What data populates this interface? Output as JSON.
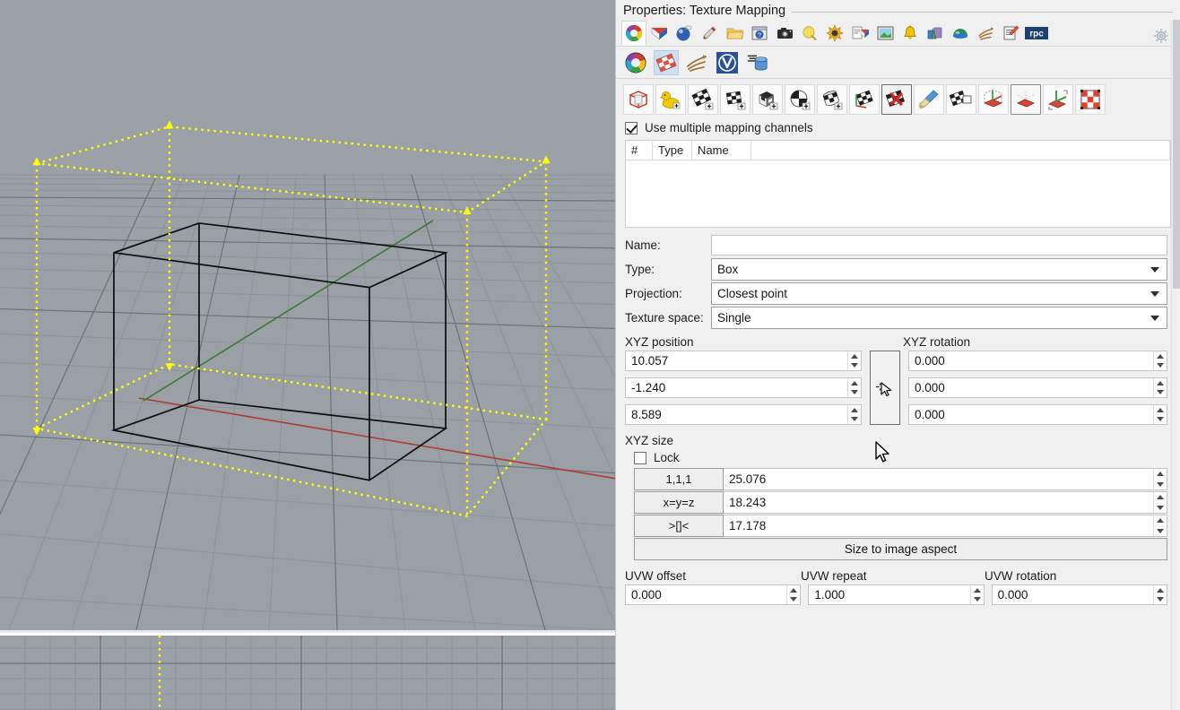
{
  "panel": {
    "title": "Properties: Texture Mapping",
    "gear_icon": "gear-icon"
  },
  "main_tabs": [
    {
      "name": "object-properties-tab",
      "icon": "color-wheel-icon",
      "selected": true
    },
    {
      "name": "layers-tab",
      "icon": "layers-icon",
      "selected": false
    },
    {
      "name": "material-tab",
      "icon": "material-sphere-icon",
      "selected": false
    },
    {
      "name": "display-tab",
      "icon": "paintbrush-icon",
      "selected": false
    },
    {
      "name": "folder-tab",
      "icon": "folder-icon",
      "selected": false
    },
    {
      "name": "help-tab",
      "icon": "help-window-icon",
      "selected": false
    },
    {
      "name": "camera-tab",
      "icon": "camera-icon",
      "selected": false
    },
    {
      "name": "light-tab",
      "icon": "lightbulb-icon",
      "selected": false
    },
    {
      "name": "sun-tab",
      "icon": "sun-icon",
      "selected": false
    },
    {
      "name": "print-width-tab",
      "icon": "document-layers-icon",
      "selected": false
    },
    {
      "name": "environment-tab",
      "icon": "picture-icon",
      "selected": false
    },
    {
      "name": "notification-tab",
      "icon": "bell-icon",
      "selected": false
    },
    {
      "name": "ground-plane-tab",
      "icon": "shapes-icon",
      "selected": false
    },
    {
      "name": "dome-tab",
      "icon": "dome-icon",
      "selected": false
    },
    {
      "name": "animation-tab",
      "icon": "claw-icon",
      "selected": false
    },
    {
      "name": "notes-tab",
      "icon": "notes-pencil-icon",
      "selected": false
    },
    {
      "name": "rpc-tab",
      "icon": "rpc-icon",
      "selected": false
    }
  ],
  "sub_tabs": [
    {
      "name": "color-sub-tab",
      "icon": "color-wheel-icon",
      "selected": false
    },
    {
      "name": "texture-mapping-sub-tab",
      "icon": "checker-plane-icon",
      "selected": true
    },
    {
      "name": "claw-sub-tab",
      "icon": "claw-icon",
      "selected": false
    },
    {
      "name": "vray-sub-tab",
      "icon": "vray-v-icon",
      "selected": false
    },
    {
      "name": "database-sub-tab",
      "icon": "database-cylinder-icon",
      "selected": false
    }
  ],
  "map_tools": [
    {
      "name": "show-mapping-widget-tool",
      "icon": "red-widget-icon",
      "state": "normal"
    },
    {
      "name": "duck-mapping-tool",
      "icon": "yellow-duck-icon",
      "state": "normal"
    },
    {
      "name": "planar-mapping-tool",
      "icon": "checker-plane-plus-icon",
      "state": "normal"
    },
    {
      "name": "planar-mapping-alt-tool",
      "icon": "checker-plane2-plus-icon",
      "state": "normal"
    },
    {
      "name": "box-mapping-tool",
      "icon": "checker-box-plus-icon",
      "state": "normal"
    },
    {
      "name": "sphere-mapping-tool",
      "icon": "checker-sphere-plus-icon",
      "state": "normal"
    },
    {
      "name": "cylinder-mapping-tool",
      "icon": "checker-cylinder-plus-icon",
      "state": "normal"
    },
    {
      "name": "custom-mapping-tool",
      "icon": "checker-axis-icon",
      "state": "normal"
    },
    {
      "name": "delete-mapping-tool",
      "icon": "checker-delete-red-x-icon",
      "state": "pressed"
    },
    {
      "name": "match-mapping-tool",
      "icon": "paintbrush-blue-icon",
      "state": "normal"
    },
    {
      "name": "copy-mapping-tool",
      "icon": "checker-copy-icon",
      "state": "normal"
    },
    {
      "name": "show-mapping-axes-tool",
      "icon": "axis-plane-dashed-icon",
      "state": "normal"
    },
    {
      "name": "unwrap-mapping-tool",
      "icon": "red-plane-icon",
      "state": "hover"
    },
    {
      "name": "apply-mapping-axes-tool",
      "icon": "axis-plane-green-icon",
      "state": "normal"
    },
    {
      "name": "checker-grid-tool",
      "icon": "red-checker-grid-icon",
      "state": "normal"
    }
  ],
  "multi_channel": {
    "label": "Use multiple mapping channels",
    "checked": true
  },
  "channel_list": {
    "columns": [
      "#",
      "Type",
      "Name"
    ],
    "rows": []
  },
  "fields": {
    "name_label": "Name:",
    "name_value": "",
    "type_label": "Type:",
    "type_value": "Box",
    "projection_label": "Projection:",
    "projection_value": "Closest point",
    "texture_space_label": "Texture space:",
    "texture_space_value": "Single"
  },
  "xyz_position": {
    "label": "XYZ position",
    "x": "10.057",
    "y": "-1.240",
    "z": "8.589"
  },
  "xyz_rotation": {
    "label": "XYZ rotation",
    "x": "0.000",
    "y": "0.000",
    "z": "0.000"
  },
  "pick_point_button": {
    "name": "pick-point-button",
    "icon": "crosshair-cursor-icon"
  },
  "xyz_size": {
    "label": "XYZ size",
    "lock_label": "Lock",
    "lock_checked": false,
    "rows": [
      {
        "button": "1,1,1",
        "value": "25.076"
      },
      {
        "button": "x=y=z",
        "value": "18.243"
      },
      {
        "button": ">[]<",
        "value": "17.178"
      }
    ],
    "size_to_aspect_label": "Size to image aspect"
  },
  "uvw": {
    "offset_label": "UVW offset",
    "offset_value": "0.000",
    "repeat_label": "UVW repeat",
    "repeat_value": "1.000",
    "rotation_label": "UVW rotation",
    "rotation_value": "0.000"
  },
  "viewport": {
    "perspective_name": "perspective-viewport",
    "top_name": "top-viewport",
    "background_color": "#9ba1a7",
    "grid_line_color": "#8b9197",
    "grid_major_color": "#6e747a",
    "object_wireframe_color": "#000000",
    "mapping_widget_color": "#ffff00",
    "x_axis_color": "#b03a34",
    "y_axis_color": "#3b7a35"
  }
}
